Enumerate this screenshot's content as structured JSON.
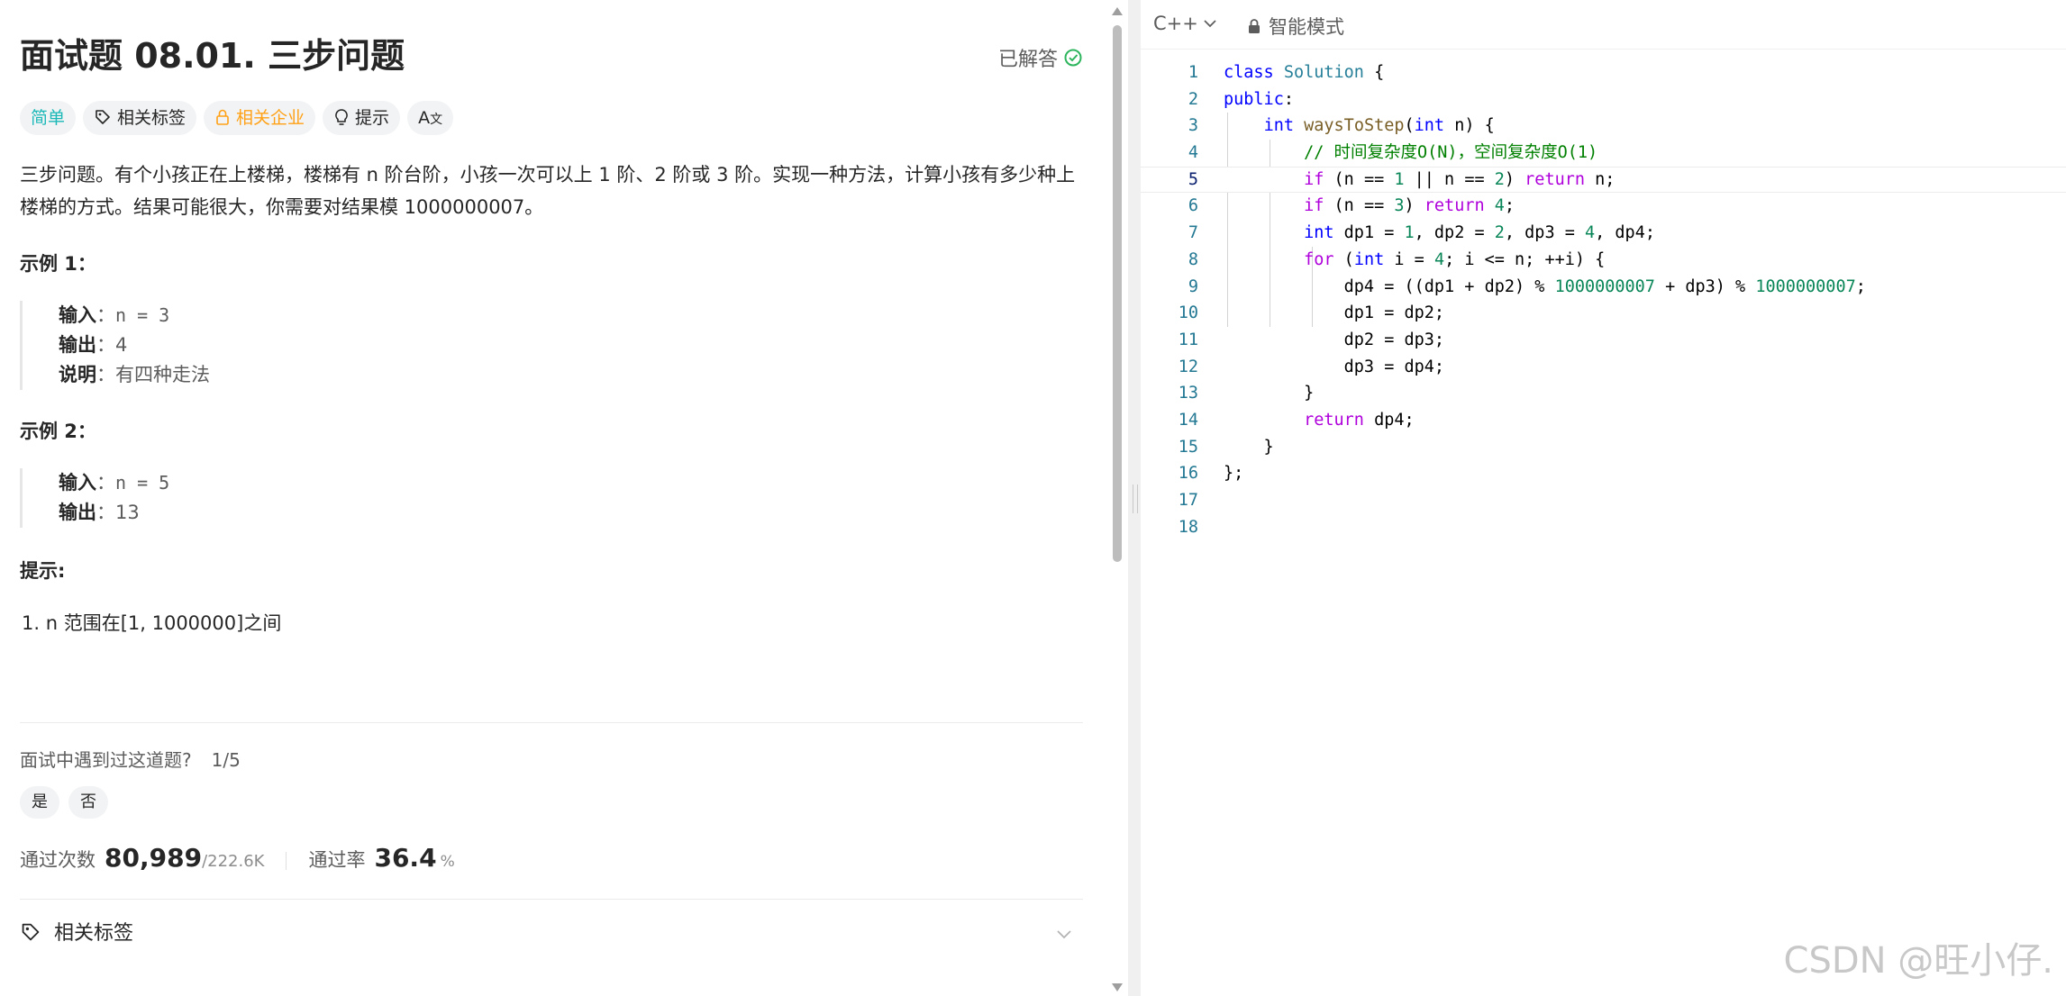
{
  "problem": {
    "title": "面试题 08.01. 三步问题",
    "status": "已解答",
    "tags": {
      "difficulty": "简单",
      "related_tags": "相关标签",
      "related_companies": "相关企业",
      "hint": "提示",
      "translate": "A"
    },
    "description": "三步问题。有个小孩正在上楼梯，楼梯有 n 阶台阶，小孩一次可以上 1 阶、2 阶或 3 阶。实现一种方法，计算小孩有多少种上楼梯的方式。结果可能很大，你需要对结果模 1000000007。",
    "examples": [
      {
        "title": "示例 1：",
        "input_label": "输入",
        "input": "n = 3",
        "output_label": "输出",
        "output": "4",
        "explain_label": "说明",
        "explain": "有四种走法"
      },
      {
        "title": "示例 2：",
        "input_label": "输入",
        "input": "n = 5",
        "output_label": "输出",
        "output": "13"
      }
    ],
    "hints_title": "提示:",
    "hints": [
      "1. n 范围在[1, 1000000]之间"
    ],
    "interview": {
      "question": "面试中遇到过这道题?",
      "ratio": "1/5",
      "yes": "是",
      "no": "否"
    },
    "stats": {
      "accepted_label": "通过次数",
      "accepted": "80,989",
      "submissions": "/222.6K",
      "rate_label": "通过率",
      "rate": "36.4",
      "rate_unit": "%"
    },
    "related_section": "相关标签"
  },
  "editor": {
    "language": "C++",
    "mode": "智能模式",
    "active_line": 5,
    "lines": [
      "1",
      "2",
      "3",
      "4",
      "5",
      "6",
      "7",
      "8",
      "9",
      "10",
      "11",
      "12",
      "13",
      "14",
      "15",
      "16",
      "17",
      "18"
    ]
  },
  "watermark": "CSDN @旺小仔.",
  "colors": {
    "easy": "#1cb8b8",
    "company": "#ffa116",
    "solved_check": "#2db55d",
    "keyword": "#0000ff",
    "control": "#af00db",
    "type": "#267f99",
    "function": "#795e26",
    "number": "#098658",
    "comment": "#008000",
    "line_number": "#237893"
  }
}
